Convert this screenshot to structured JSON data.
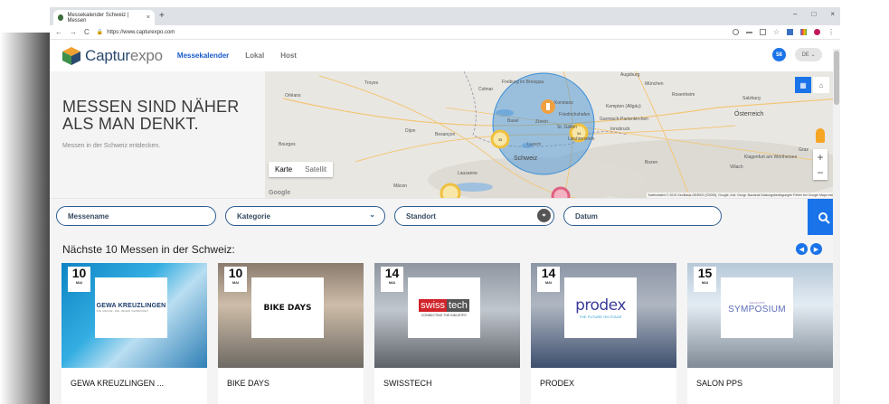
{
  "browser": {
    "tab_title": "Messekalender Schweiz | Messen",
    "tab_close": "×",
    "new_tab": "+",
    "url": "https://www.capturexpo.com",
    "nav_back": "←",
    "nav_forward": "→",
    "nav_reload": "C",
    "window_controls": [
      "–",
      "□",
      "×"
    ]
  },
  "header": {
    "logo_a": "Captur",
    "logo_b": "expo",
    "nav": [
      "Messekalender",
      "Lokal",
      "Host"
    ],
    "badge": "58",
    "language": "DE"
  },
  "hero": {
    "title_line1": "MESSEN SIND NÄHER",
    "title_line2": "ALS MAN DENKT.",
    "subtitle": "Messen in der Schweiz entdecken."
  },
  "map": {
    "type_map": "Karte",
    "type_satellite": "Satellit",
    "zoom_in": "+",
    "zoom_out": "−",
    "cluster_labels": [
      "35",
      "34"
    ],
    "place_labels": [
      "Troyes",
      "Orléans",
      "Bourges",
      "Dijon",
      "Besançon",
      "Freiburg im Breisgau",
      "Colmar",
      "München",
      "Augsburg",
      "Rosenheim",
      "Salzburg",
      "Österreich",
      "Kempten (Allgäu)",
      "Garmisch-Partenkirchen",
      "Innsbruck",
      "Friedrichshafen",
      "Konstanz",
      "Zürich",
      "Basel",
      "St. Gallen",
      "Luzern",
      "Liechtenstein",
      "Schweiz",
      "Bozen",
      "Villach",
      "Klagenfurt am Wörthersee",
      "Graz",
      "Lausanne",
      "Mâcon"
    ],
    "attribution": "Kartendaten © 2019 GeoBasis-DE/BKG (©2009), Google, Inst. Geogr. Nacional   Nutzungsbedingungen   Fehler bei Google Maps melden",
    "google": "Google"
  },
  "search": {
    "name_placeholder": "Messename",
    "category_placeholder": "Kategorie",
    "location_placeholder": "Standort",
    "date_placeholder": "Datum"
  },
  "listing": {
    "title": "Nächste 10 Messen in der Schweiz:",
    "cards": [
      {
        "day": "10",
        "month": "MAI",
        "name": "GEWA KREUZLINGEN ...",
        "logo": "GEWA KREUZLINGEN",
        "logo_sub": "DIE MESSE, DIE JEDER VERBINDET"
      },
      {
        "day": "10",
        "month": "MAI",
        "name": "BIKE DAYS",
        "logo": "BIKE DAYS"
      },
      {
        "day": "14",
        "month": "MAI",
        "name": "SWISSTECH",
        "logo_a": "swiss",
        "logo_b": "tech",
        "logo_sub": "CONNECTING THE INDUSTRY"
      },
      {
        "day": "14",
        "month": "MAI",
        "name": "PRODEX",
        "logo": "prodex",
        "logo_sub": "THE FUTURE ON STAGE"
      },
      {
        "day": "15",
        "month": "MAI",
        "name": "SALON PPS",
        "logo": "SYMPOSIUM",
        "logo_sub": "SALON PPS"
      }
    ]
  },
  "colors": {
    "accent": "#1a73e8",
    "pill_border": "#2c5c8f",
    "cluster": "#f0c040",
    "radius_circle": "#3a8fd8"
  }
}
